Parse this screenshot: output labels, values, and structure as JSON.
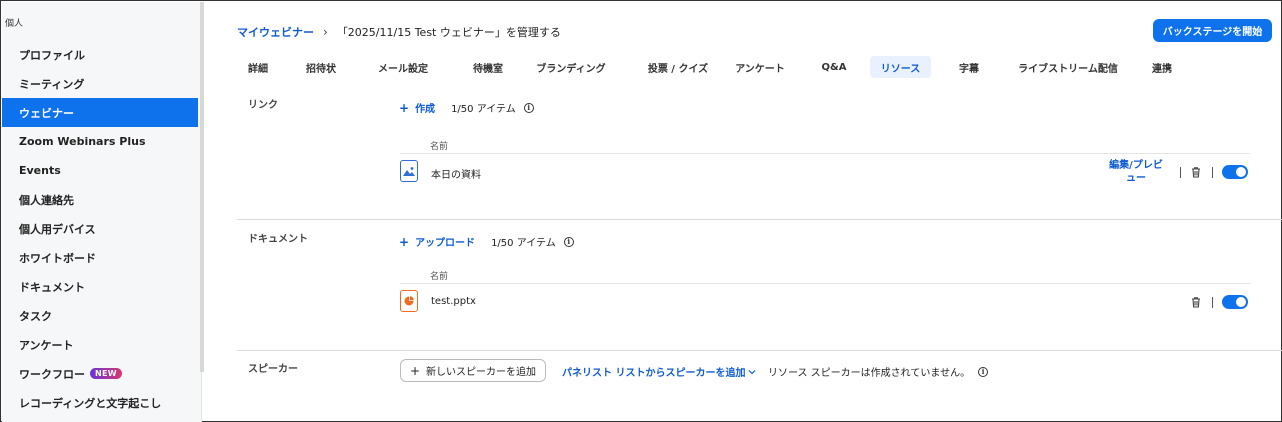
{
  "sidebar": {
    "section": "個人",
    "items": [
      {
        "label": "プロファイル"
      },
      {
        "label": "ミーティング"
      },
      {
        "label": "ウェビナー",
        "active": true
      },
      {
        "label": "Zoom Webinars Plus"
      },
      {
        "label": "Events"
      },
      {
        "label": "個人連絡先"
      },
      {
        "label": "個人用デバイス"
      },
      {
        "label": "ホワイトボード"
      },
      {
        "label": "ドキュメント"
      },
      {
        "label": "タスク"
      },
      {
        "label": "アンケート"
      },
      {
        "label": "ワークフロー",
        "badge": "NEW"
      },
      {
        "label": "レコーディングと文字起こし"
      }
    ]
  },
  "header": {
    "breadcrumb_link": "マイウェビナー",
    "breadcrumb_sep": "›",
    "breadcrumb_current": "「2025/11/15 Test ウェビナー」を管理する",
    "backstage_button": "バックステージを開始"
  },
  "tabs": [
    {
      "label": "詳細"
    },
    {
      "label": "招待状"
    },
    {
      "label": "メール設定"
    },
    {
      "label": "待機室"
    },
    {
      "label": "ブランディング"
    },
    {
      "label": "投票 / クイズ"
    },
    {
      "label": "アンケート"
    },
    {
      "label": "Q&A"
    },
    {
      "label": "リソース",
      "active": true
    },
    {
      "label": "字幕"
    },
    {
      "label": "ライブストリーム配信"
    },
    {
      "label": "連携"
    }
  ],
  "links": {
    "label": "リンク",
    "action": "作成",
    "count": "1/50 アイテム",
    "column_header": "名前",
    "item_name": "本日の資料",
    "edit_label_line1": "編集/プレビ",
    "edit_label_line2": "ュー",
    "toggle_on": true
  },
  "documents": {
    "label": "ドキュメント",
    "action": "アップロード",
    "count": "1/50 アイテム",
    "column_header": "名前",
    "item_name": "test.pptx",
    "toggle_on": true
  },
  "speakers": {
    "label": "スピーカー",
    "add_button": "新しいスピーカーを追加",
    "panelist_link": "パネリスト リストからスピーカーを追加",
    "empty_text": "リソース スピーカーは作成されていません。"
  },
  "colors": {
    "accent": "#0e72ed",
    "link": "#0e5bd1",
    "pptx_orange": "#f26b1d"
  }
}
